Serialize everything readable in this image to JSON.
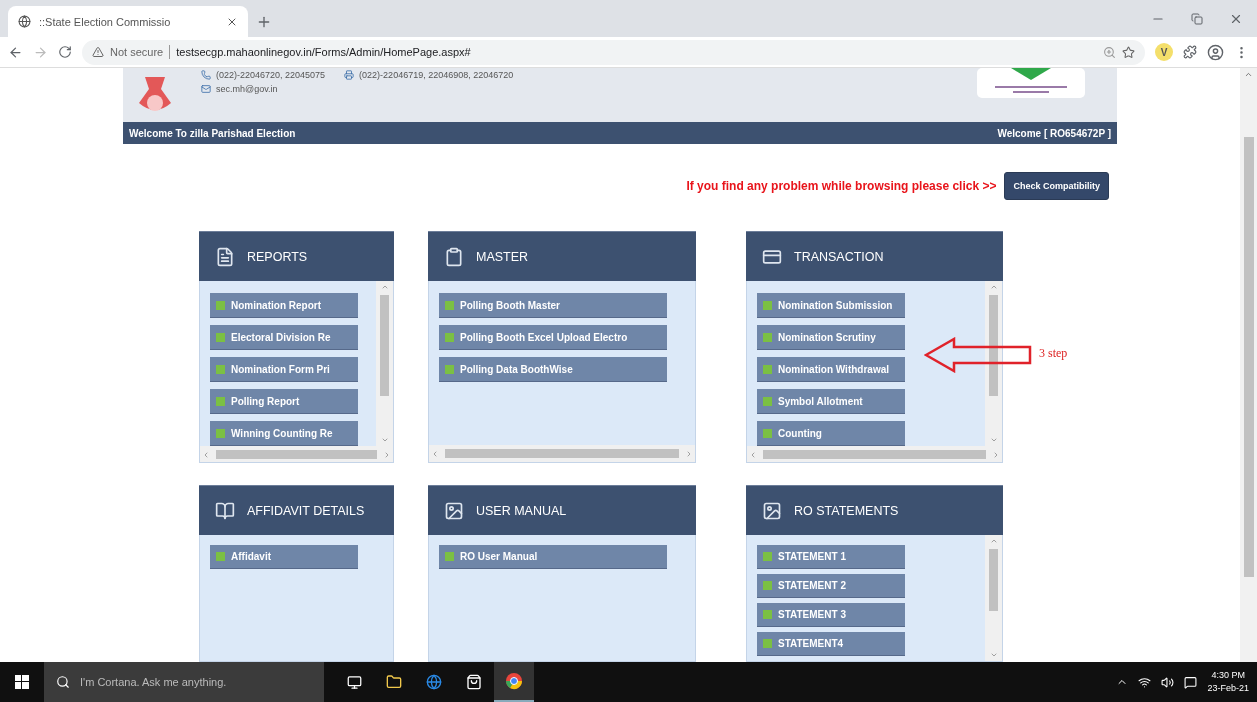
{
  "browser": {
    "tab": {
      "title": "::State Election Commissio"
    },
    "address": {
      "security": "Not secure",
      "url": "testsecgp.mahaonlinegov.in/Forms/Admin/HomePage.aspx#"
    },
    "extension_badge": "V"
  },
  "header": {
    "phone": "(022)-22046720, 22045075",
    "fax": "(022)-22046719, 22046908, 22046720",
    "email": "sec.mh@gov.in"
  },
  "welcome_bar": {
    "left": "Welcome To zilla Parishad Election",
    "right": "Welcome [ RO654672P ]"
  },
  "notice": {
    "text": "If you find any problem while browsing please click >>",
    "button": "Check Compatibility"
  },
  "panels": [
    {
      "title": "REPORTS",
      "items": [
        "Nomination Report",
        "Electoral Division Re",
        "Nomination Form Pri",
        "Polling Report",
        "Winning Counting Re"
      ]
    },
    {
      "title": "MASTER",
      "items": [
        "Polling Booth Master",
        "Polling Booth Excel Upload Electro",
        "Polling Data BoothWise"
      ]
    },
    {
      "title": "TRANSACTION",
      "annotation": "3 step",
      "items": [
        "Nomination Submission",
        "Nomination Scrutiny",
        "Nomination Withdrawal",
        "Symbol Allotment",
        "Counting"
      ]
    },
    {
      "title": "AFFIDAVIT DETAILS",
      "items": [
        "Affidavit"
      ]
    },
    {
      "title": "USER MANUAL",
      "items": [
        "RO User Manual"
      ]
    },
    {
      "title": "RO STATEMENTS",
      "items": [
        "STATEMENT 1",
        "STATEMENT 2",
        "STATEMENT 3",
        "STATEMENT4"
      ]
    }
  ],
  "taskbar": {
    "search_placeholder": "I'm Cortana. Ask me anything.",
    "time": "4:30 PM",
    "date": "23-Feb-21"
  }
}
